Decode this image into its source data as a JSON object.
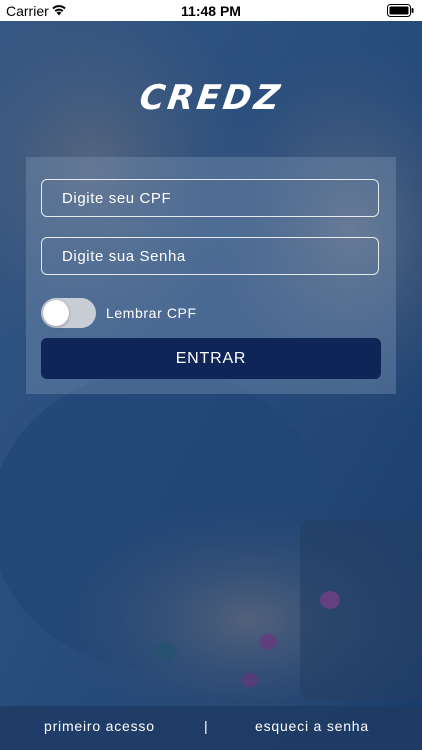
{
  "status_bar": {
    "carrier": "Carrier",
    "time": "11:48 PM"
  },
  "brand": {
    "logo_text": "CREDZ"
  },
  "login": {
    "cpf_placeholder": "Digite seu CPF",
    "password_placeholder": "Digite sua Senha",
    "remember_label": "Lembrar CPF",
    "remember_on": false,
    "submit_label": "ENTRAR"
  },
  "footer": {
    "first_access": "primeiro acesso",
    "separator": "|",
    "forgot_password": "esqueci a senha"
  },
  "colors": {
    "button": "#0f2557",
    "overlay": "#163868",
    "text": "#ffffff"
  }
}
